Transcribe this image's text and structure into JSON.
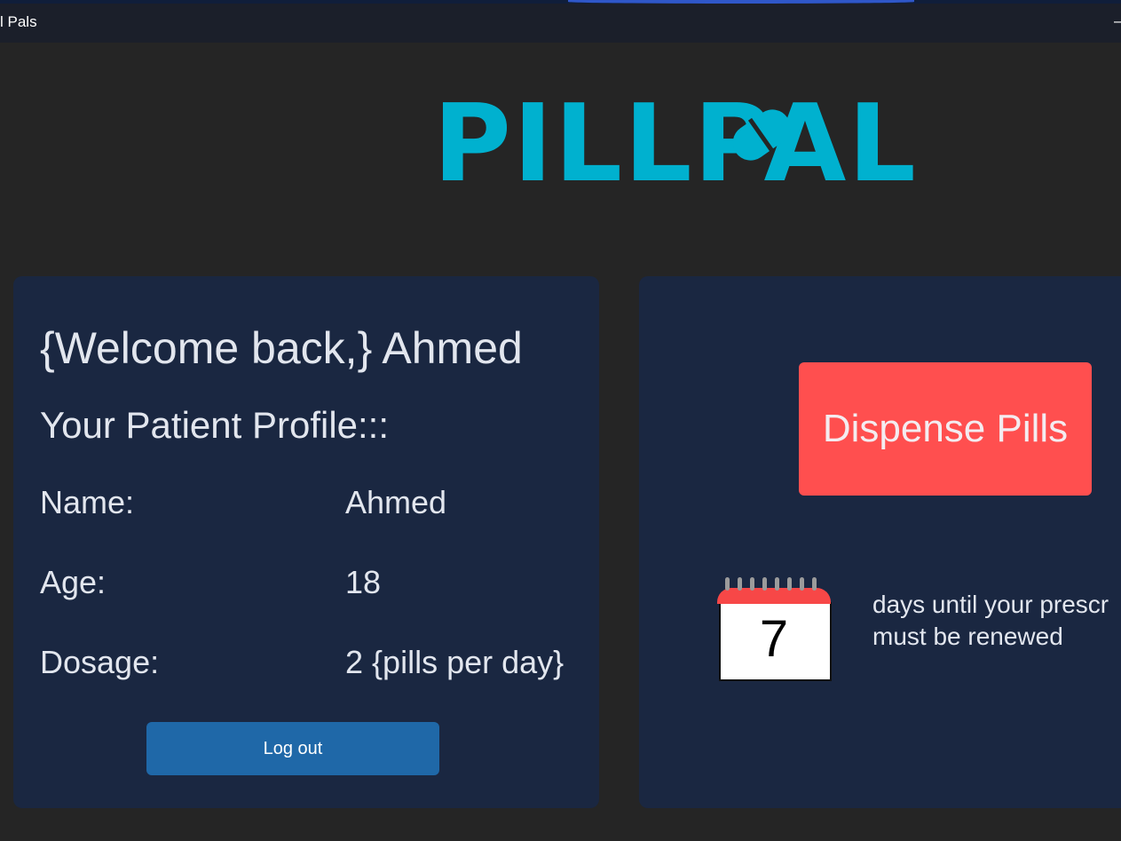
{
  "window": {
    "title": "l Pals",
    "minimize_glyph": "–"
  },
  "logo": {
    "text": "PILLPAL",
    "icon": "pill-icon",
    "color": "#00b1cf"
  },
  "profile": {
    "welcome": "{Welcome back,} Ahmed",
    "heading": "Your Patient Profile:::",
    "fields": [
      {
        "label": "Name:",
        "value": "Ahmed"
      },
      {
        "label": "Age:",
        "value": "18"
      },
      {
        "label": "Dosage:",
        "value": "2 {pills per day}"
      }
    ],
    "logout_label": "Log out"
  },
  "actions": {
    "dispense_label": "Dispense Pills",
    "dispense_color": "#ff4f4f"
  },
  "prescription": {
    "days_remaining": "7",
    "line1": "days until your prescr",
    "line2": "must be renewed",
    "icon": "calendar-icon"
  },
  "colors": {
    "background": "#252525",
    "panel": "#1a2741",
    "logout_button": "#1f68a8"
  }
}
